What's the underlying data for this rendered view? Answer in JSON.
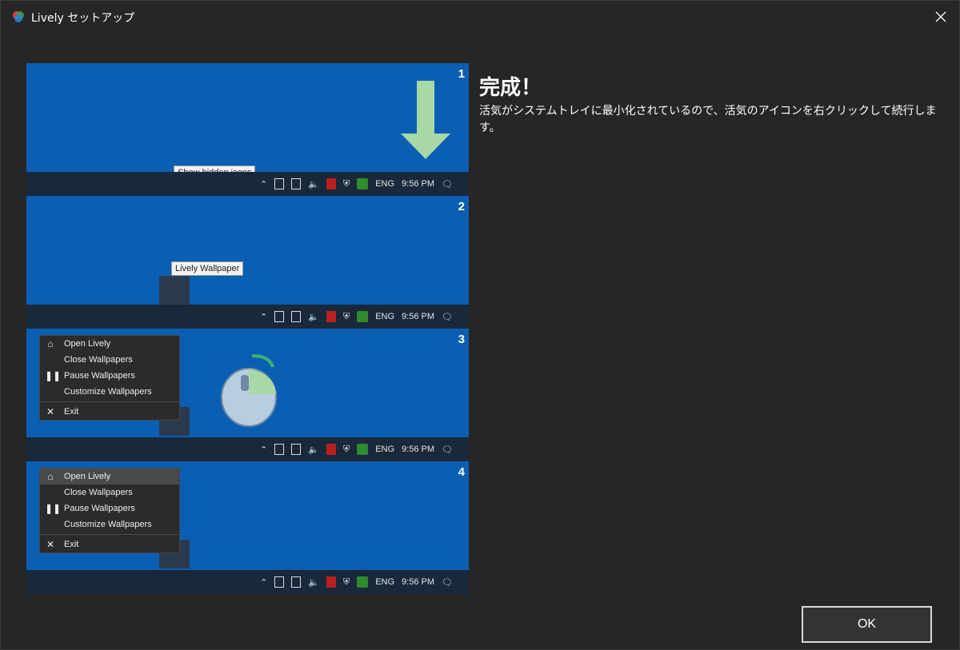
{
  "window": {
    "title": "Lively セットアップ"
  },
  "heading": "完成！",
  "description": "活気がシステムトレイに最小化されているので、活気のアイコンを右クリックして続行します。",
  "ok_label": "OK",
  "illustration": {
    "panel_numbers": [
      "1",
      "2",
      "3",
      "4"
    ],
    "tooltip_show_hidden": "Show hidden icons",
    "tooltip_lively": "Lively Wallpaper",
    "taskbar": {
      "lang": "ENG",
      "time": "9:56 PM"
    },
    "menu": [
      "Open Lively",
      "Close Wallpapers",
      "Pause Wallpapers",
      "Customize Wallpapers",
      "Exit"
    ]
  }
}
